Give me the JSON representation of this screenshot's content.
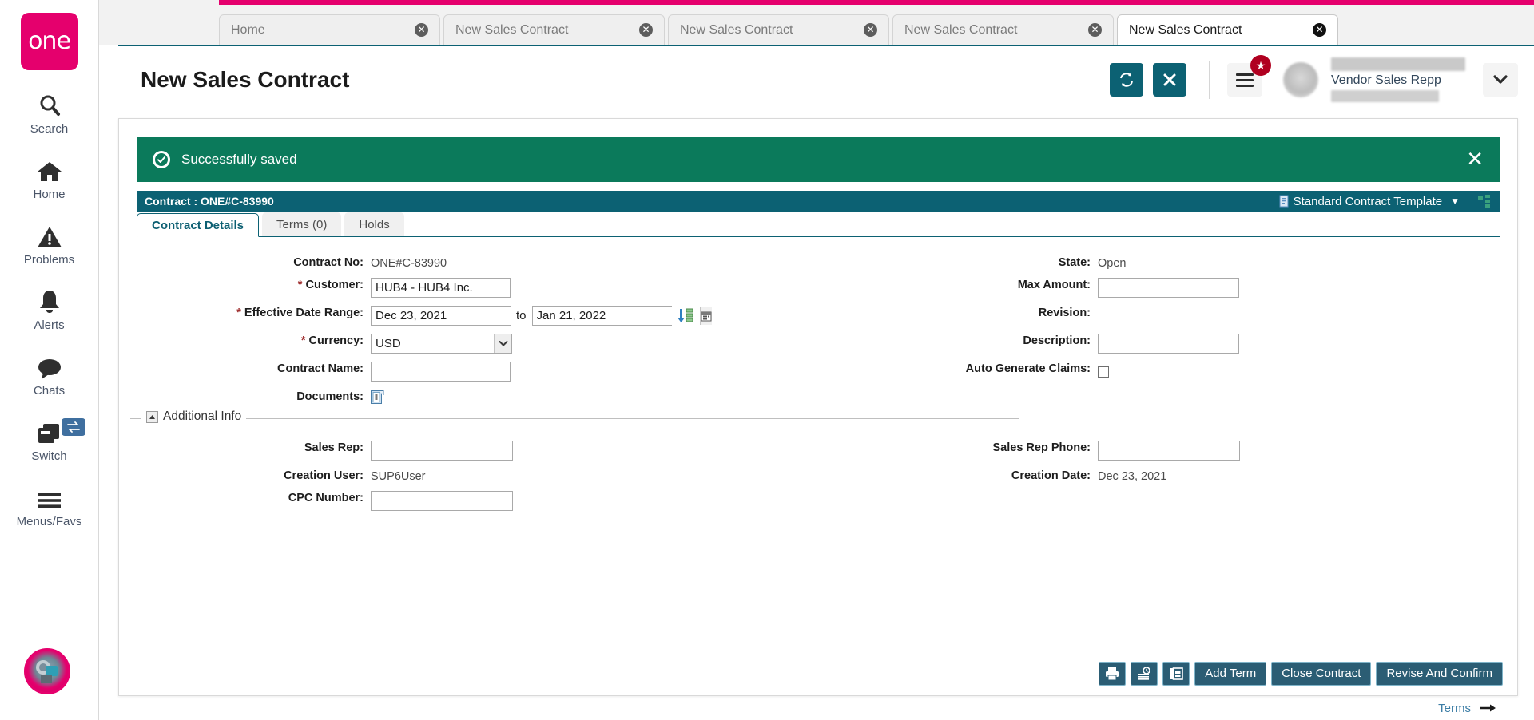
{
  "brand": {
    "logo_text": "one",
    "accent": "#e5006d"
  },
  "rail": {
    "items": [
      {
        "label": "Search",
        "icon": "search-icon"
      },
      {
        "label": "Home",
        "icon": "home-icon"
      },
      {
        "label": "Problems",
        "icon": "warning-icon"
      },
      {
        "label": "Alerts",
        "icon": "bell-icon"
      },
      {
        "label": "Chats",
        "icon": "chat-bubble-icon"
      },
      {
        "label": "Switch",
        "icon": "switch-windows-icon"
      },
      {
        "label": "Menus/Favs",
        "icon": "hamburger-icon"
      }
    ]
  },
  "tabs": [
    {
      "label": "Home",
      "active": false
    },
    {
      "label": "New Sales Contract",
      "active": false
    },
    {
      "label": "New Sales Contract",
      "active": false
    },
    {
      "label": "New Sales Contract",
      "active": false
    },
    {
      "label": "New Sales Contract",
      "active": true
    }
  ],
  "header": {
    "title": "New Sales Contract",
    "refresh_icon": "refresh-icon",
    "close_icon": "close-x-icon",
    "menu_icon": "hamburger-menu-icon",
    "badge_icon": "star-badge-icon",
    "user_role": "Vendor Sales Repp",
    "caret_icon": "chevron-down-icon"
  },
  "alert": {
    "message": "Successfully saved",
    "color": "#0b7a5b",
    "check_icon": "check-circle-icon",
    "close_icon": "close-x-icon"
  },
  "contract_bar": {
    "title": "Contract : ONE#C-83990",
    "template_label": "Standard Contract Template",
    "template_icon": "document-icon",
    "caret_icon": "caret-down-icon",
    "hierarchy_icon": "hierarchy-icon",
    "color": "#0c6173"
  },
  "content_tabs": [
    {
      "label": "Contract Details",
      "active": true
    },
    {
      "label": "Terms (0)",
      "active": false
    },
    {
      "label": "Holds",
      "active": false
    }
  ],
  "form": {
    "left": {
      "contract_no_label": "Contract No:",
      "contract_no_value": "ONE#C-83990",
      "customer_label": "Customer:",
      "customer_value": "HUB4 - HUB4 Inc.",
      "effective_label": "Effective Date Range:",
      "effective_from": "Dec 23, 2021",
      "effective_to": "Jan 21, 2022",
      "to_word": "to",
      "currency_label": "Currency:",
      "currency_value": "USD",
      "contract_name_label": "Contract Name:",
      "contract_name_value": "",
      "documents_label": "Documents:",
      "documents_icon": "documents-icon",
      "calendar_icon": "calendar-icon",
      "recurrence_icon": "date-generator-icon",
      "required_mark": "*"
    },
    "right": {
      "state_label": "State:",
      "state_value": "Open",
      "max_amount_label": "Max Amount:",
      "max_amount_value": "",
      "revision_label": "Revision:",
      "revision_value": "",
      "description_label": "Description:",
      "description_value": "",
      "auto_claims_label": "Auto Generate Claims:",
      "auto_claims_checked": false
    }
  },
  "additional_info": {
    "legend": "Additional Info",
    "collapse_icon": "collapse-triangle-icon",
    "sales_rep_label": "Sales Rep:",
    "sales_rep_value": "",
    "sales_rep_phone_label": "Sales Rep Phone:",
    "sales_rep_phone_value": "",
    "creation_user_label": "Creation User:",
    "creation_user_value": "SUP6User",
    "creation_date_label": "Creation Date:",
    "creation_date_value": "Dec 23, 2021",
    "cpc_number_label": "CPC Number:",
    "cpc_number_value": ""
  },
  "terms_link": {
    "label": "Terms",
    "icon": "arrow-right-icon"
  },
  "footer": {
    "print_icon": "print-icon",
    "history_icon": "history-icon",
    "copy_icon": "copy-icon",
    "add_term": "Add Term",
    "close_contract": "Close Contract",
    "revise_confirm": "Revise And Confirm"
  }
}
